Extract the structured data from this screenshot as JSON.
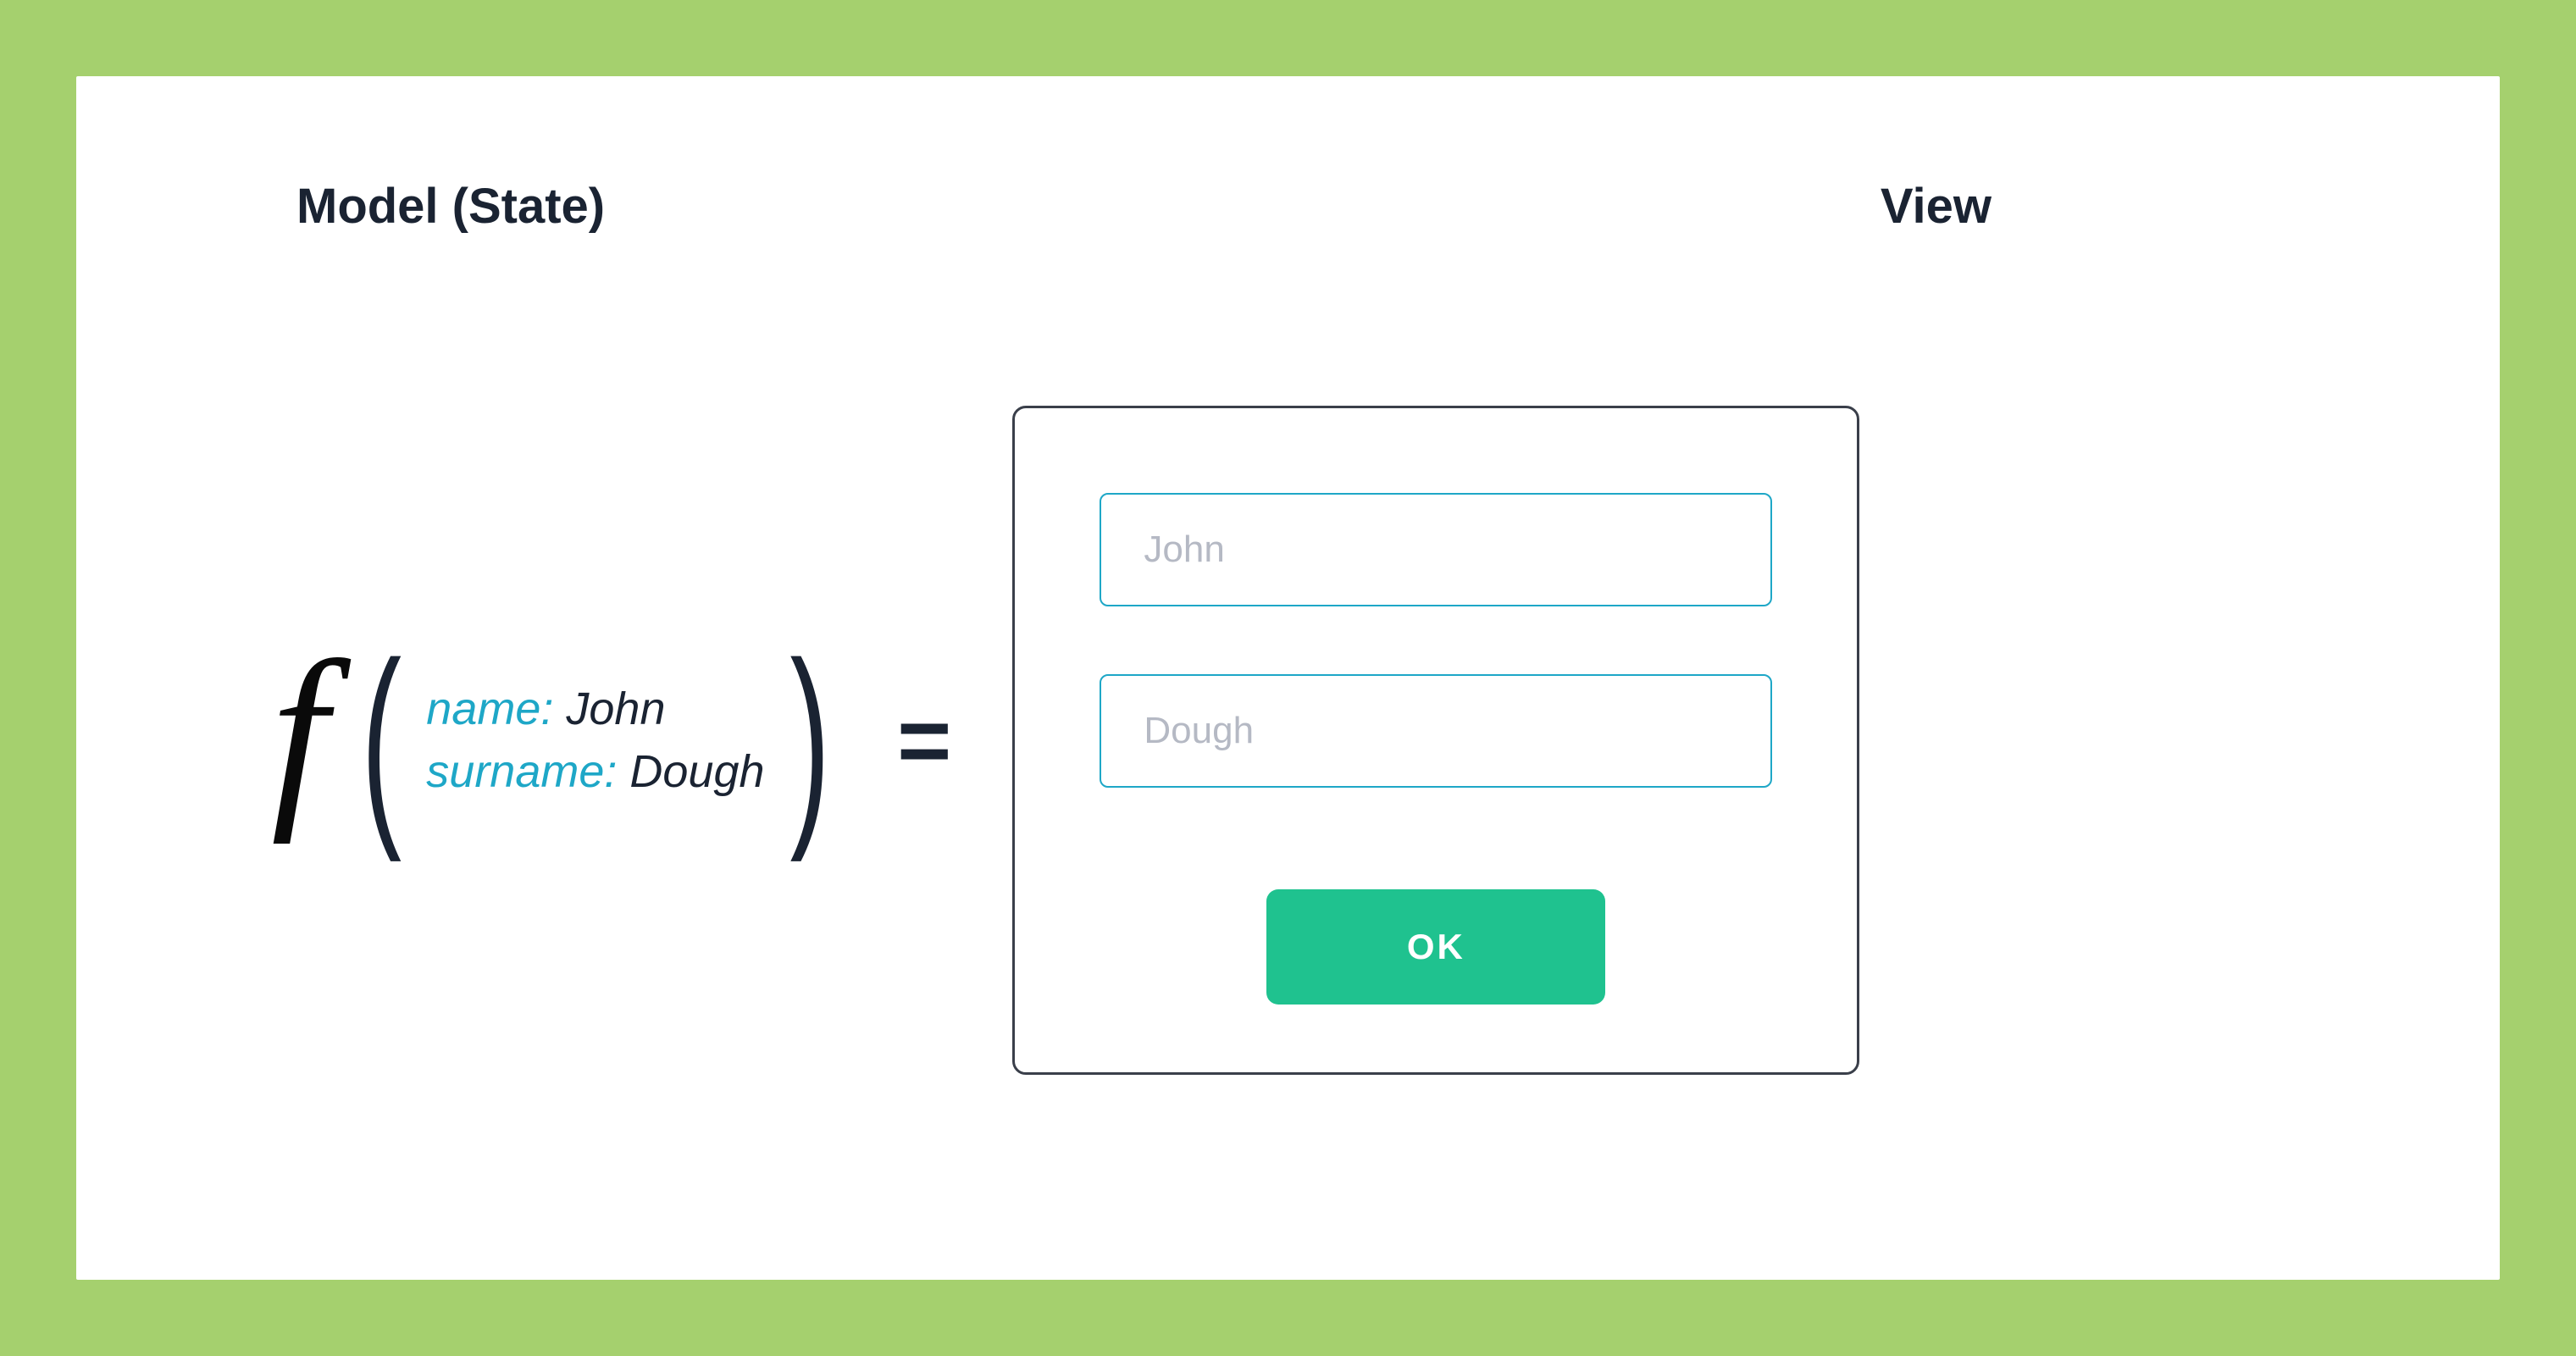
{
  "titles": {
    "model": "Model (State)",
    "view": "View"
  },
  "function": {
    "symbol": "f",
    "open_paren": "(",
    "close_paren": ")",
    "equals": "="
  },
  "state": {
    "name_key": "name:",
    "name_value": " John",
    "surname_key": "surname:",
    "surname_value": " Dough"
  },
  "view": {
    "name_input": "John",
    "surname_input": "Dough",
    "ok_label": "OK"
  },
  "colors": {
    "page_bg": "#a5d06e",
    "card_bg": "#ffffff",
    "text_dark": "#1a2332",
    "accent_blue": "#1ea7c7",
    "input_placeholder": "#b5b9c4",
    "button_bg": "#1fc28f",
    "button_text": "#ffffff",
    "panel_border": "#3a3f4a"
  }
}
